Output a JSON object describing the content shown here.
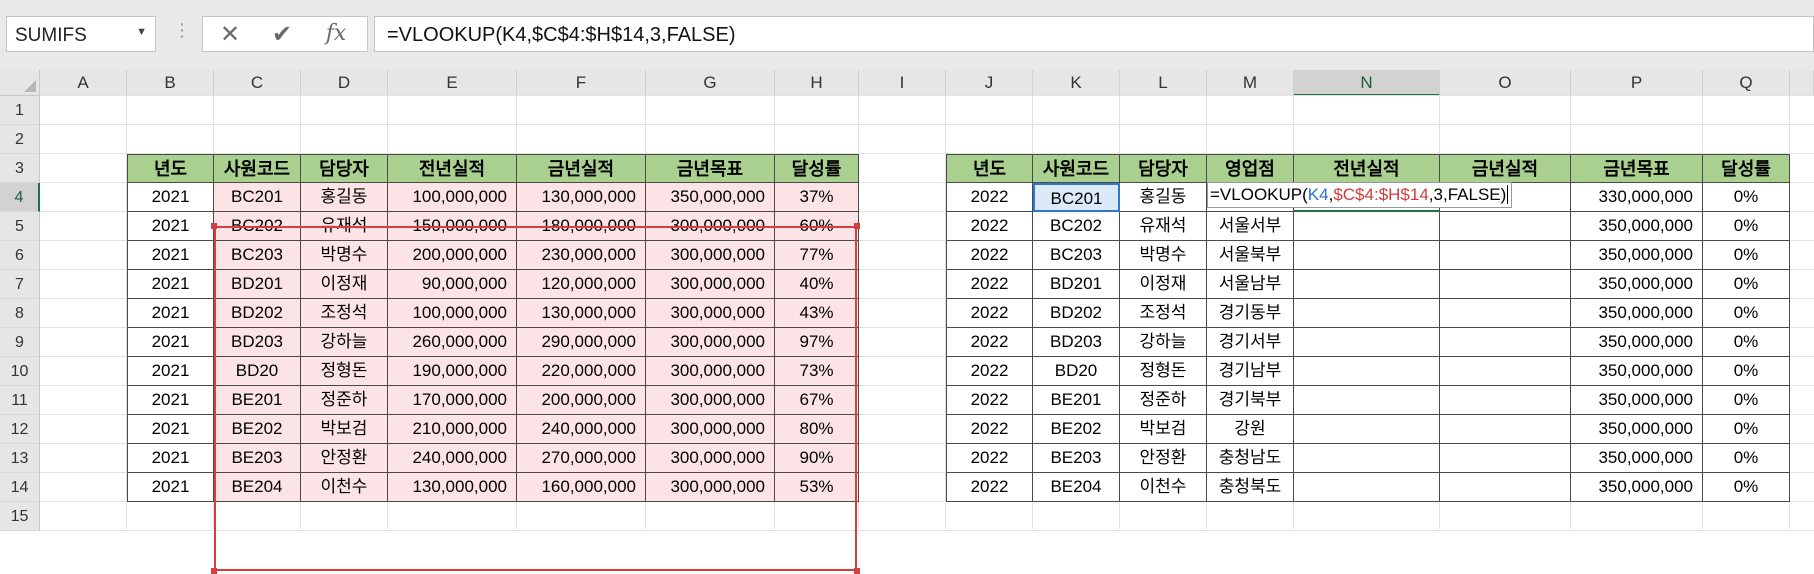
{
  "formula_bar": {
    "name_box": "SUMIFS",
    "cancel_icon": "✕",
    "enter_icon": "✔",
    "fx_label": "fx",
    "formula": "=VLOOKUP(K4,$C$4:$H$14,3,FALSE)"
  },
  "columns": [
    "A",
    "B",
    "C",
    "D",
    "E",
    "F",
    "G",
    "H",
    "I",
    "J",
    "K",
    "L",
    "M",
    "N",
    "O",
    "P",
    "Q"
  ],
  "rows": [
    "1",
    "2",
    "3",
    "4",
    "5",
    "6",
    "7",
    "8",
    "9",
    "10",
    "11",
    "12",
    "13",
    "14",
    "15"
  ],
  "table1": {
    "headers": [
      "년도",
      "사원코드",
      "담당자",
      "전년실적",
      "금년실적",
      "금년목표",
      "달성률"
    ],
    "rows": [
      [
        "2021",
        "BC201",
        "홍길동",
        "100,000,000",
        "130,000,000",
        "350,000,000",
        "37%"
      ],
      [
        "2021",
        "BC202",
        "유재석",
        "150,000,000",
        "180,000,000",
        "300,000,000",
        "60%"
      ],
      [
        "2021",
        "BC203",
        "박명수",
        "200,000,000",
        "230,000,000",
        "300,000,000",
        "77%"
      ],
      [
        "2021",
        "BD201",
        "이정재",
        "90,000,000",
        "120,000,000",
        "300,000,000",
        "40%"
      ],
      [
        "2021",
        "BD202",
        "조정석",
        "100,000,000",
        "130,000,000",
        "300,000,000",
        "43%"
      ],
      [
        "2021",
        "BD203",
        "강하늘",
        "260,000,000",
        "290,000,000",
        "300,000,000",
        "97%"
      ],
      [
        "2021",
        "BD20",
        "정형돈",
        "190,000,000",
        "220,000,000",
        "300,000,000",
        "73%"
      ],
      [
        "2021",
        "BE201",
        "정준하",
        "170,000,000",
        "200,000,000",
        "300,000,000",
        "67%"
      ],
      [
        "2021",
        "BE202",
        "박보검",
        "210,000,000",
        "240,000,000",
        "300,000,000",
        "80%"
      ],
      [
        "2021",
        "BE203",
        "안정환",
        "240,000,000",
        "270,000,000",
        "300,000,000",
        "90%"
      ],
      [
        "2021",
        "BE204",
        "이천수",
        "130,000,000",
        "160,000,000",
        "300,000,000",
        "53%"
      ]
    ]
  },
  "table2": {
    "headers": [
      "년도",
      "사원코드",
      "담당자",
      "영업점",
      "전년실적",
      "금년실적",
      "금년목표",
      "달성률"
    ],
    "rows": [
      [
        "2022",
        "BC201",
        "홍길동",
        "",
        "",
        "",
        "330,000,000",
        "0%"
      ],
      [
        "2022",
        "BC202",
        "유재석",
        "서울서부",
        "",
        "",
        "350,000,000",
        "0%"
      ],
      [
        "2022",
        "BC203",
        "박명수",
        "서울북부",
        "",
        "",
        "350,000,000",
        "0%"
      ],
      [
        "2022",
        "BD201",
        "이정재",
        "서울남부",
        "",
        "",
        "350,000,000",
        "0%"
      ],
      [
        "2022",
        "BD202",
        "조정석",
        "경기동부",
        "",
        "",
        "350,000,000",
        "0%"
      ],
      [
        "2022",
        "BD203",
        "강하늘",
        "경기서부",
        "",
        "",
        "350,000,000",
        "0%"
      ],
      [
        "2022",
        "BD20",
        "정형돈",
        "경기남부",
        "",
        "",
        "350,000,000",
        "0%"
      ],
      [
        "2022",
        "BE201",
        "정준하",
        "경기북부",
        "",
        "",
        "350,000,000",
        "0%"
      ],
      [
        "2022",
        "BE202",
        "박보검",
        "강원",
        "",
        "",
        "350,000,000",
        "0%"
      ],
      [
        "2022",
        "BE203",
        "안정환",
        "충청남도",
        "",
        "",
        "350,000,000",
        "0%"
      ],
      [
        "2022",
        "BE204",
        "이천수",
        "충청북도",
        "",
        "",
        "350,000,000",
        "0%"
      ]
    ]
  },
  "in_cell_formula": {
    "parts": [
      {
        "text": "=VLOOKUP(",
        "color": "#000000"
      },
      {
        "text": "K4",
        "color": "#2f6fd6"
      },
      {
        "text": ",",
        "color": "#000000"
      },
      {
        "text": "$C$4:$H$14",
        "color": "#d23b3b"
      },
      {
        "text": ",3,FALSE)",
        "color": "#000000"
      }
    ]
  },
  "colors": {
    "header_green": "#a9d08e",
    "range_pink": "#fce4e6",
    "range_border": "#d63f3f",
    "active_blue": "#2f76cd",
    "selection_green": "#217346"
  }
}
